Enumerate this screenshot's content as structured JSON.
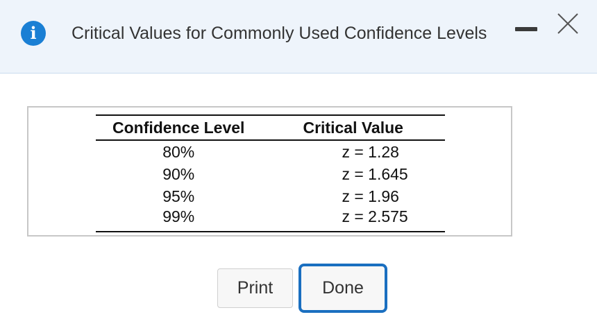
{
  "dialog": {
    "title": "Critical Values for Commonly Used Confidence Levels",
    "info_icon_glyph": "i",
    "icons": [
      "info-icon",
      "close-icon"
    ]
  },
  "table": {
    "headers": [
      "Confidence Level",
      "Critical Value"
    ],
    "rows": [
      {
        "level": "80%",
        "value": "z = 1.28"
      },
      {
        "level": "90%",
        "value": "z = 1.645"
      },
      {
        "level": "95%",
        "value": "z = 1.96"
      },
      {
        "level": "99%",
        "value": "z = 2.575"
      }
    ]
  },
  "buttons": {
    "print_label": "Print",
    "done_label": "Done"
  },
  "colors": {
    "header_bg": "#eef4fb",
    "info_icon": "#1a7fd4",
    "focus_border": "#1a6fc0"
  }
}
